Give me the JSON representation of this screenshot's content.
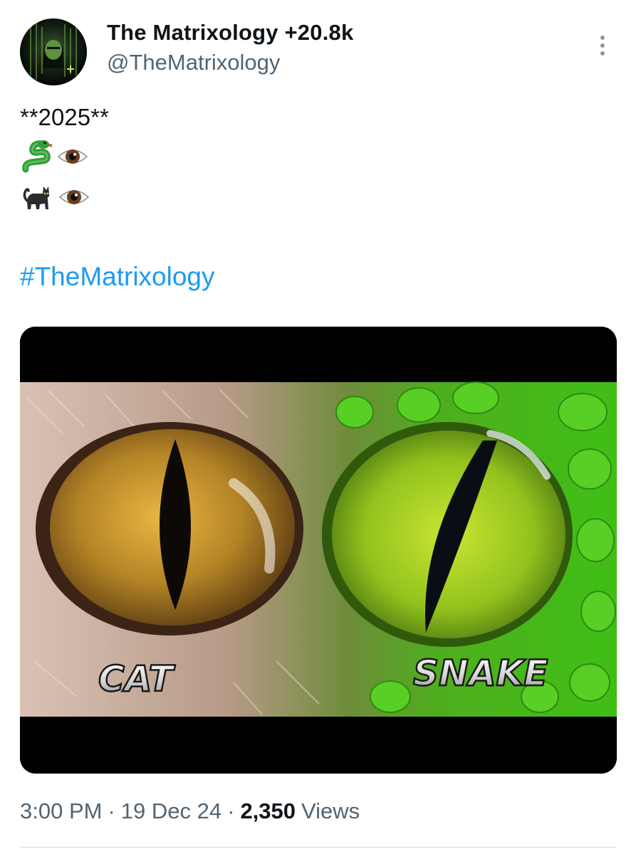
{
  "author": {
    "display_name": "The Matrixology +20.8k",
    "handle": "@TheMatrixology"
  },
  "tweet": {
    "line1": "**2025**",
    "row1_emoji": [
      "snake-emoji",
      "eye-emoji"
    ],
    "row2_emoji": [
      "black-cat-emoji",
      "eye-emoji"
    ],
    "hashtag": "#TheMatrixology"
  },
  "media": {
    "left_caption": "CAT",
    "right_caption": "SNAKE"
  },
  "meta": {
    "time": "3:00 PM",
    "separator": "·",
    "date": "19 Dec 24",
    "views_count": "2,350",
    "views_label": "Views"
  },
  "colors": {
    "link": "#1d9bf0",
    "secondary_text": "#536471",
    "primary_text": "#0f1419"
  }
}
